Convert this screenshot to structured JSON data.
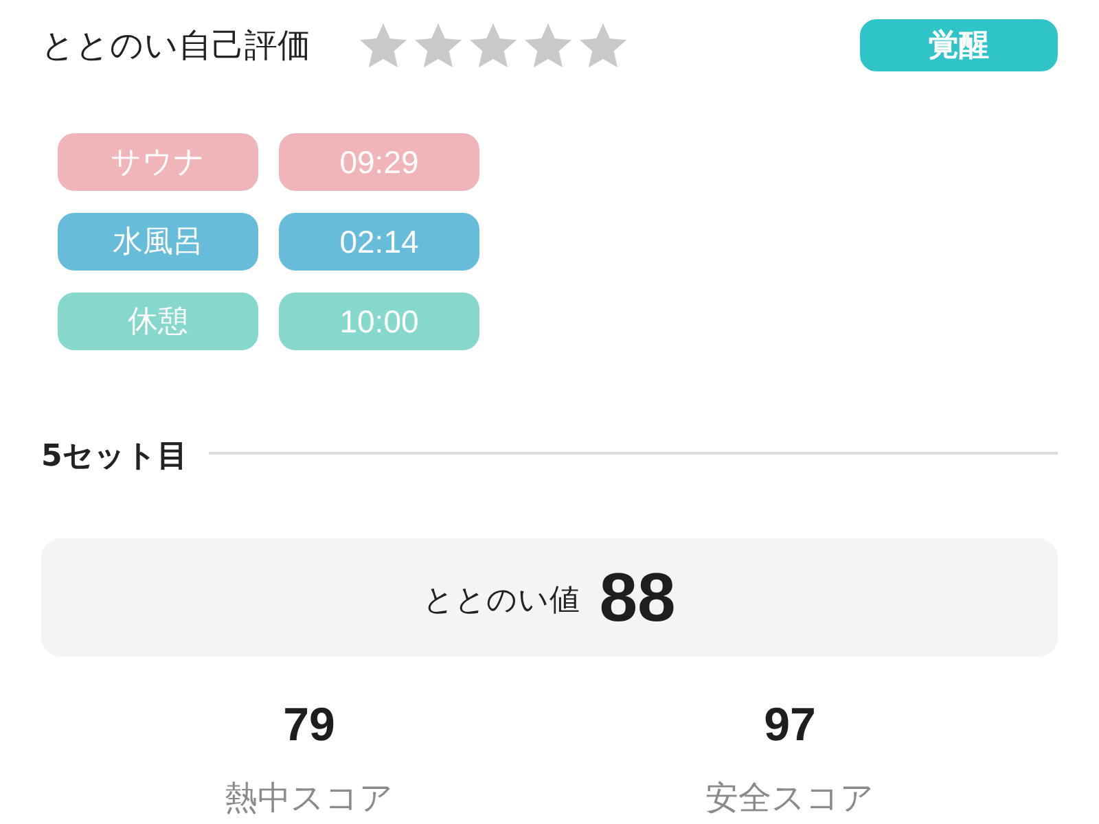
{
  "header": {
    "title": "ととのい自己評価",
    "rating": {
      "stars": 0
    },
    "badge": {
      "label": "覚醒"
    }
  },
  "phases": [
    {
      "name": "サウナ",
      "time": "09:29",
      "color": "#efb5b8"
    },
    {
      "name": "水風呂",
      "time": "02:14",
      "color": "#67bdd9"
    },
    {
      "name": "休憩",
      "time": "10:00",
      "color": "#85d8cb"
    }
  ],
  "set_section": {
    "title": "5セット目"
  },
  "totonoi": {
    "label": "ととのい値",
    "value": "88"
  },
  "scores": [
    {
      "value": "79",
      "label": "熱中スコア"
    },
    {
      "value": "97",
      "label": "安全スコア"
    }
  ]
}
